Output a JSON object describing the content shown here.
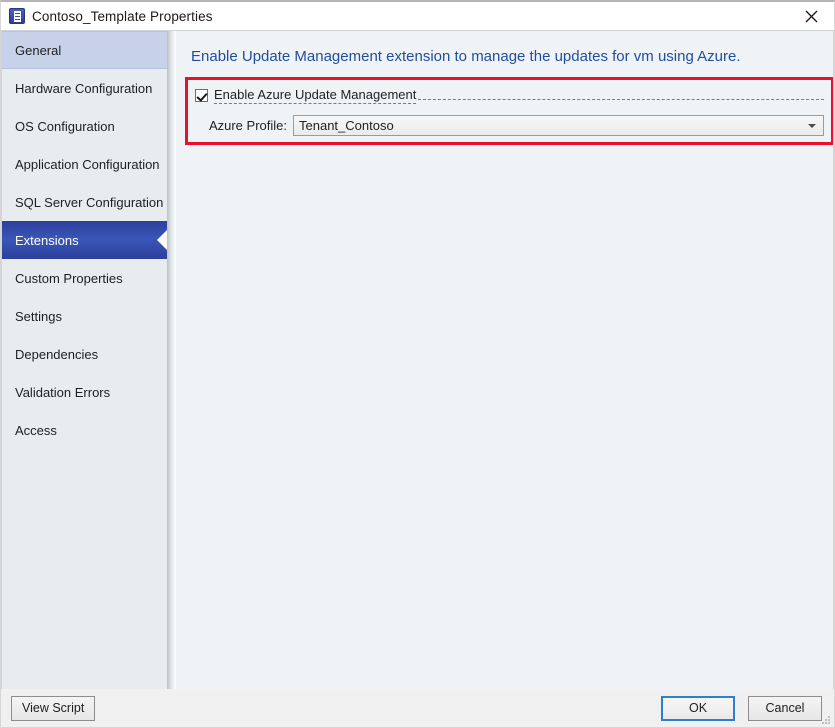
{
  "window": {
    "title": "Contoso_Template Properties",
    "icon": "properties-document-icon",
    "close_label": "✕"
  },
  "sidebar": {
    "items": [
      {
        "label": "General",
        "state": "hovered"
      },
      {
        "label": "Hardware Configuration",
        "state": "normal"
      },
      {
        "label": "OS Configuration",
        "state": "normal"
      },
      {
        "label": "Application Configuration",
        "state": "normal"
      },
      {
        "label": "SQL Server Configuration",
        "state": "normal"
      },
      {
        "label": "Extensions",
        "state": "selected"
      },
      {
        "label": "Custom Properties",
        "state": "normal"
      },
      {
        "label": "Settings",
        "state": "normal"
      },
      {
        "label": "Dependencies",
        "state": "normal"
      },
      {
        "label": "Validation Errors",
        "state": "normal"
      },
      {
        "label": "Access",
        "state": "normal"
      }
    ]
  },
  "content": {
    "header": "Enable Update Management extension to manage the updates for vm using Azure.",
    "header_color": "#1f4e9c",
    "highlight_color": "#e8112d",
    "checkbox": {
      "label": "Enable Azure Update Management",
      "checked": true
    },
    "profile": {
      "label": "Azure Profile:",
      "value": "Tenant_Contoso",
      "arrow_icon": "chevron-down-icon"
    }
  },
  "footer": {
    "view_script_label": "View Script",
    "ok_label": "OK",
    "cancel_label": "Cancel",
    "default_button": "OK",
    "focus_color": "#2f7fd1"
  }
}
